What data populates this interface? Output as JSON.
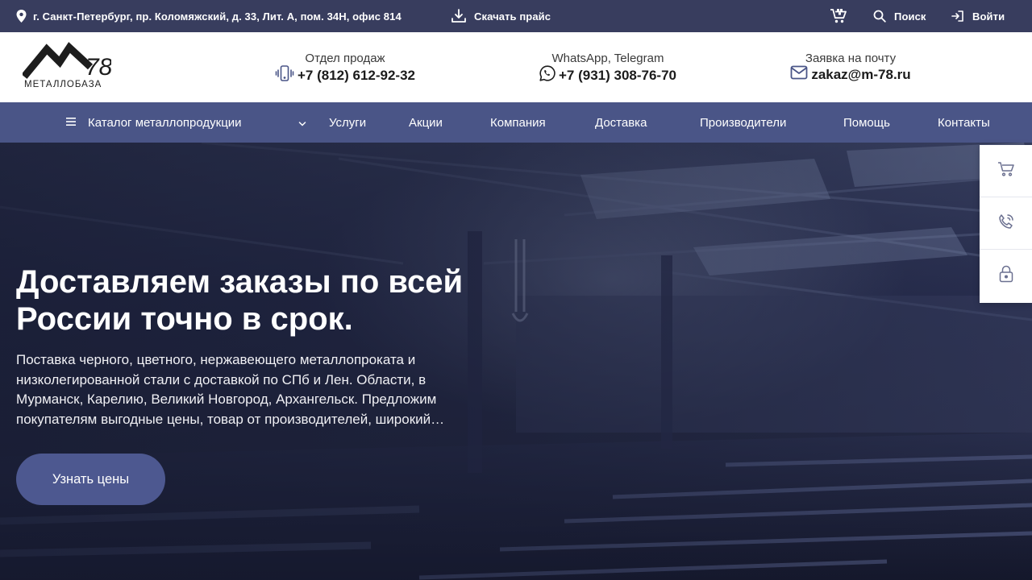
{
  "topbar": {
    "address": "г. Санкт-Петербург, пр. Коломяжский, д. 33, Лит. А, пом. 34Н, офис 814",
    "price_download": "Скачать прайс",
    "search": "Поиск",
    "login": "Войти"
  },
  "header": {
    "logo_number": "78",
    "logo_text": "МЕТАЛЛОБАЗА",
    "sales": {
      "label": "Отдел продаж",
      "phone": "+7 (812) 612-92-32"
    },
    "messengers": {
      "label": "WhatsApp, Telegram",
      "phone": "+7 (931) 308-76-70"
    },
    "email": {
      "label": "Заявка на почту",
      "address": "zakaz@m-78.ru"
    }
  },
  "nav": {
    "catalog": "Каталог металлопродукции",
    "items": [
      "Услуги",
      "Акции",
      "Компания",
      "Доставка",
      "Производители",
      "Помощь",
      "Контакты"
    ]
  },
  "hero": {
    "title": "Доставляем заказы по всей России точно в срок.",
    "text": "Поставка черного, цветного, нержавеющего металлопроката и низколегированной стали с доставкой по СПб и Лен. Области, в Мурманск, Карелию, Великий Новгород, Архангельск. Предложим покупателям выгодные цены, товар от производителей, широкий…",
    "button": "Узнать цены"
  },
  "side_panel": {
    "icons": [
      "cart-icon",
      "phone-call-icon",
      "lock-icon"
    ]
  },
  "colors": {
    "topbar": "#383d5e",
    "nav": "#4a5587",
    "button": "#4d5890"
  }
}
